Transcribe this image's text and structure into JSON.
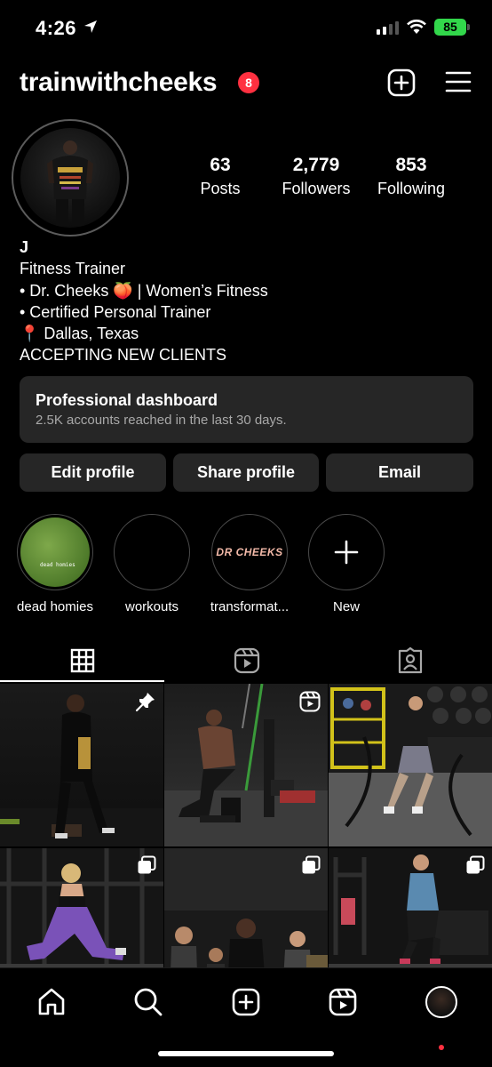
{
  "status_bar": {
    "time": "4:26",
    "battery": "85"
  },
  "header": {
    "username": "trainwithcheeks",
    "notification_count": "8"
  },
  "stats": [
    {
      "value": "63",
      "label": "Posts"
    },
    {
      "value": "2,779",
      "label": "Followers"
    },
    {
      "value": "853",
      "label": "Following"
    }
  ],
  "bio": {
    "name": "J",
    "lines": [
      "Fitness Trainer",
      "• Dr. Cheeks 🍑 | Women’s Fitness",
      "• Certified Personal Trainer",
      "📍 Dallas, Texas",
      "ACCEPTING NEW CLIENTS"
    ]
  },
  "dashboard": {
    "title": "Professional dashboard",
    "subtitle": "2.5K accounts reached in the last 30 days."
  },
  "buttons": {
    "edit": "Edit profile",
    "share": "Share profile",
    "email": "Email"
  },
  "highlights": [
    {
      "label": "dead homies",
      "cover_text": "dead homies"
    },
    {
      "label": "workouts"
    },
    {
      "label": "transformat...",
      "cover_text": "DR CHEEKS"
    },
    {
      "label": "New"
    }
  ],
  "tabs": [
    "grid-icon",
    "reels-icon",
    "tagged-icon"
  ],
  "grid": [
    {
      "icon": "pin-icon"
    },
    {
      "icon": "reel-icon"
    },
    {
      "icon": ""
    },
    {
      "icon": "carousel-icon"
    },
    {
      "icon": "carousel-icon"
    },
    {
      "icon": "carousel-icon"
    }
  ],
  "nav": [
    "home-icon",
    "search-icon",
    "create-icon",
    "reels-icon",
    "profile-avatar"
  ],
  "colors": {
    "background": "#000000",
    "card": "#262626",
    "badge": "#ff3040",
    "battery": "#32d74b"
  }
}
